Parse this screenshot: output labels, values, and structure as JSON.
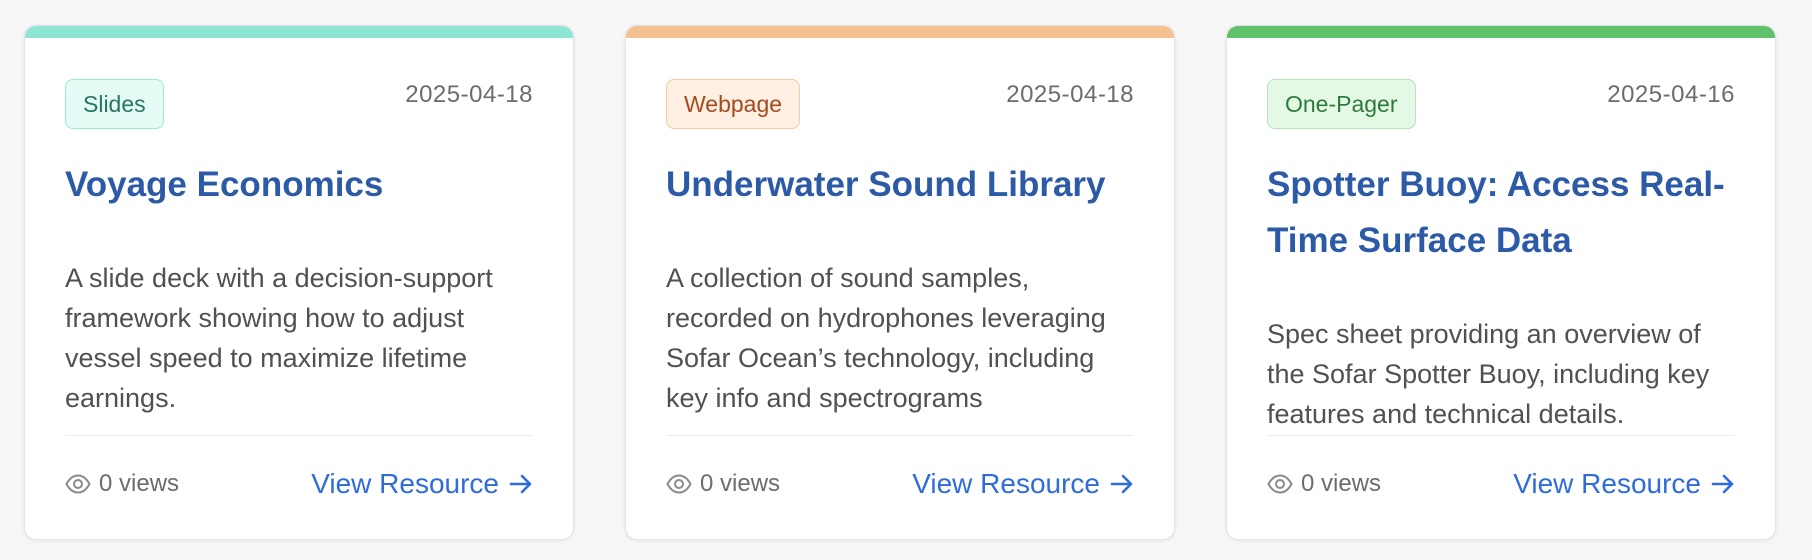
{
  "colors": {
    "title": "#2d5aa6",
    "link": "#2f6bdb",
    "muted": "#6b6b70",
    "body_text": "#505055"
  },
  "icons": {
    "views": "eye-icon",
    "link": "arrow-right-icon"
  },
  "cards": [
    {
      "accent_color": "#8de5d3",
      "badge": {
        "label": "Slides",
        "bg": "#e4faf5",
        "border": "#9fe8d7",
        "text": "#2a7566"
      },
      "date": "2025-04-18",
      "title": "Voyage Economics",
      "description": "A slide deck with a decision-support framework showing how to adjust vessel speed to maximize lifetime earnings.",
      "views": "0 views",
      "link_label": "View Resource"
    },
    {
      "accent_color": "#f3c190",
      "badge": {
        "label": "Webpage",
        "bg": "#fdf0e2",
        "border": "#f5cc9f",
        "text": "#a54a1c"
      },
      "date": "2025-04-18",
      "title": "Underwater Sound Library",
      "description": "A collection of sound samples, recorded on hydrophones leveraging Sofar Ocean’s technology, including key info and spectrograms",
      "views": "0 views",
      "link_label": "View Resource"
    },
    {
      "accent_color": "#5fc169",
      "badge": {
        "label": "One-Pager",
        "bg": "#e4f8e6",
        "border": "#b3e6ba",
        "text": "#2f7a3b"
      },
      "date": "2025-04-16",
      "title": "Spotter Buoy: Access Real-Time Surface Data",
      "description": "Spec sheet providing an overview of the Sofar Spotter Buoy, including key features and technical details.",
      "views": "0 views",
      "link_label": "View Resource"
    }
  ]
}
